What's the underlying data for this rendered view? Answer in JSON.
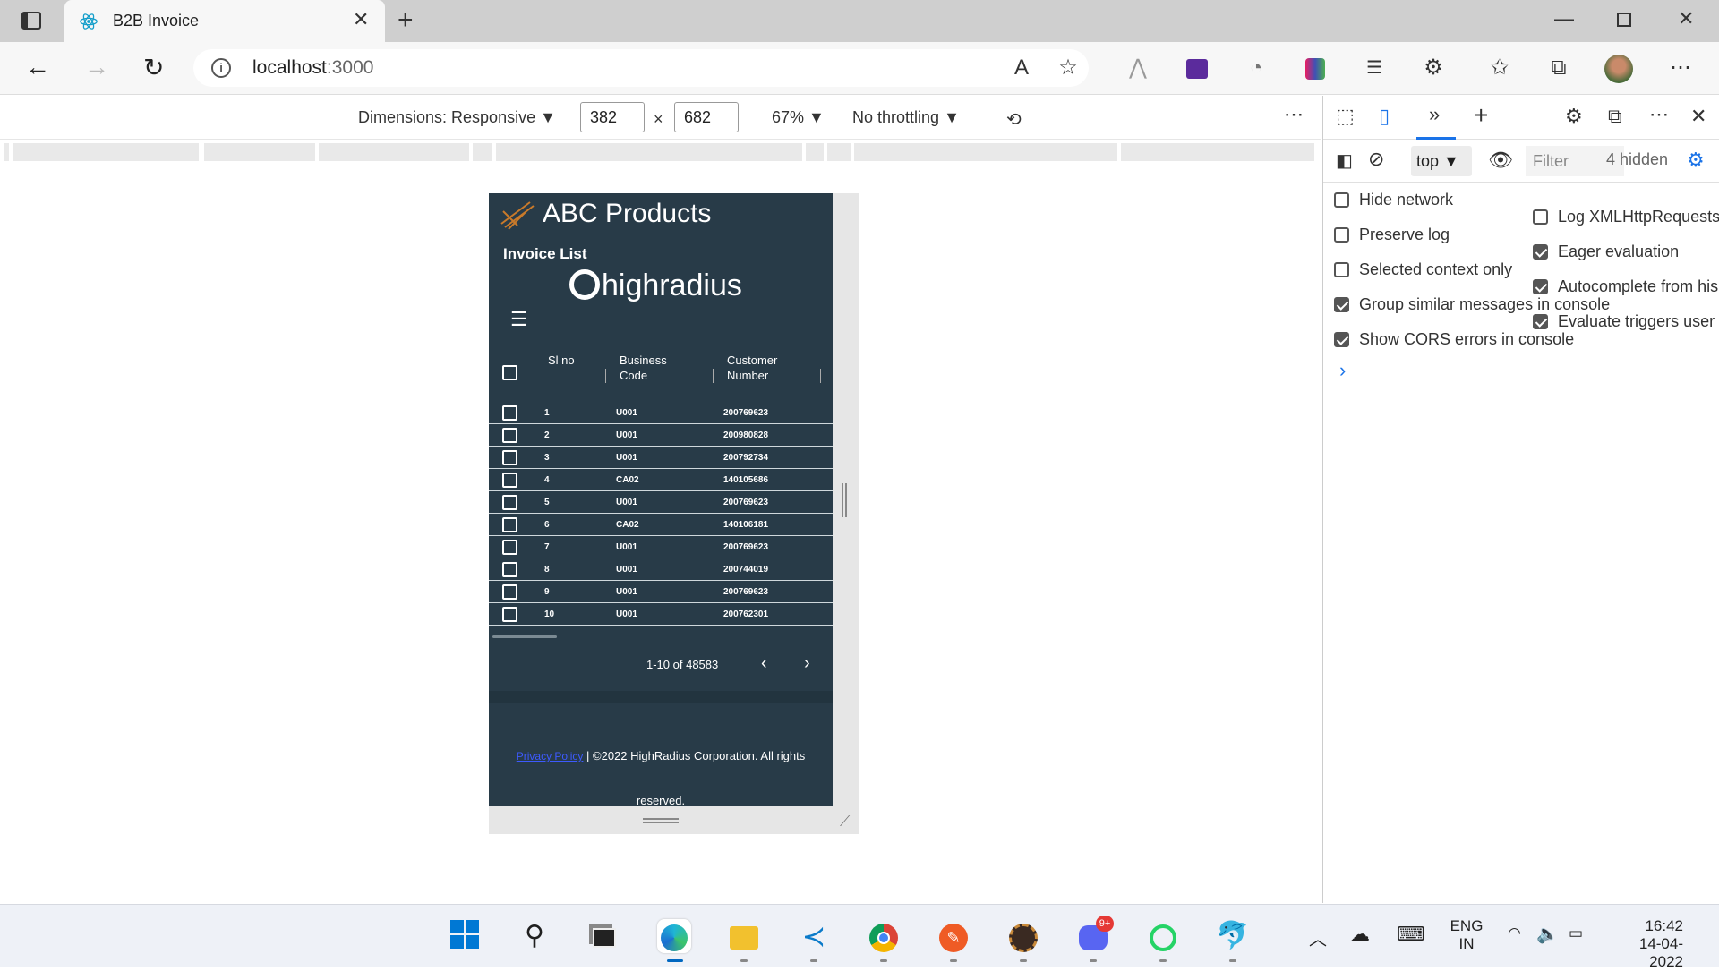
{
  "browser": {
    "tab_title": "B2B Invoice",
    "url_host": "localhost",
    "url_port": ":3000"
  },
  "devtoolbar": {
    "dimensions_label": "Dimensions: Responsive",
    "width": "382",
    "height": "682",
    "zoom": "67%",
    "throttling": "No throttling",
    "times": "×"
  },
  "app": {
    "brand": "ABC Products",
    "page_title": "Invoice List",
    "partner_logo": "highradius",
    "columns": [
      "Sl no",
      "Business Code",
      "Customer Number"
    ],
    "rows": [
      [
        "1",
        "U001",
        "200769623"
      ],
      [
        "2",
        "U001",
        "200980828"
      ],
      [
        "3",
        "U001",
        "200792734"
      ],
      [
        "4",
        "CA02",
        "140105686"
      ],
      [
        "5",
        "U001",
        "200769623"
      ],
      [
        "6",
        "CA02",
        "140106181"
      ],
      [
        "7",
        "U001",
        "200769623"
      ],
      [
        "8",
        "U001",
        "200744019"
      ],
      [
        "9",
        "U001",
        "200769623"
      ],
      [
        "10",
        "U001",
        "200762301"
      ]
    ],
    "pagination": "1-10 of 48583",
    "footer_link": "Privacy Policy",
    "footer_text": "| ©2022 HighRadius Corporation. All rights",
    "footer_text2": "reserved."
  },
  "devtools": {
    "context": "top",
    "filter_placeholder": "Filter",
    "hidden": "4 hidden",
    "options_left": [
      {
        "label": "Hide network",
        "checked": false
      },
      {
        "label": "Preserve log",
        "checked": false
      },
      {
        "label": "Selected context only",
        "checked": false
      },
      {
        "label": "Group similar messages in console",
        "checked": true
      },
      {
        "label": "Show CORS errors in console",
        "checked": true
      }
    ],
    "options_right": [
      {
        "label": "Log XMLHttpRequests",
        "checked": false
      },
      {
        "label": "Eager evaluation",
        "checked": true
      },
      {
        "label": "Autocomplete from his",
        "checked": true
      },
      {
        "label": "Evaluate triggers user a",
        "checked": true
      }
    ],
    "prompt": "›"
  },
  "taskbar": {
    "lang": "ENG",
    "region": "IN",
    "time": "16:42",
    "date": "14-04-2022",
    "discord_badge": "9+"
  }
}
